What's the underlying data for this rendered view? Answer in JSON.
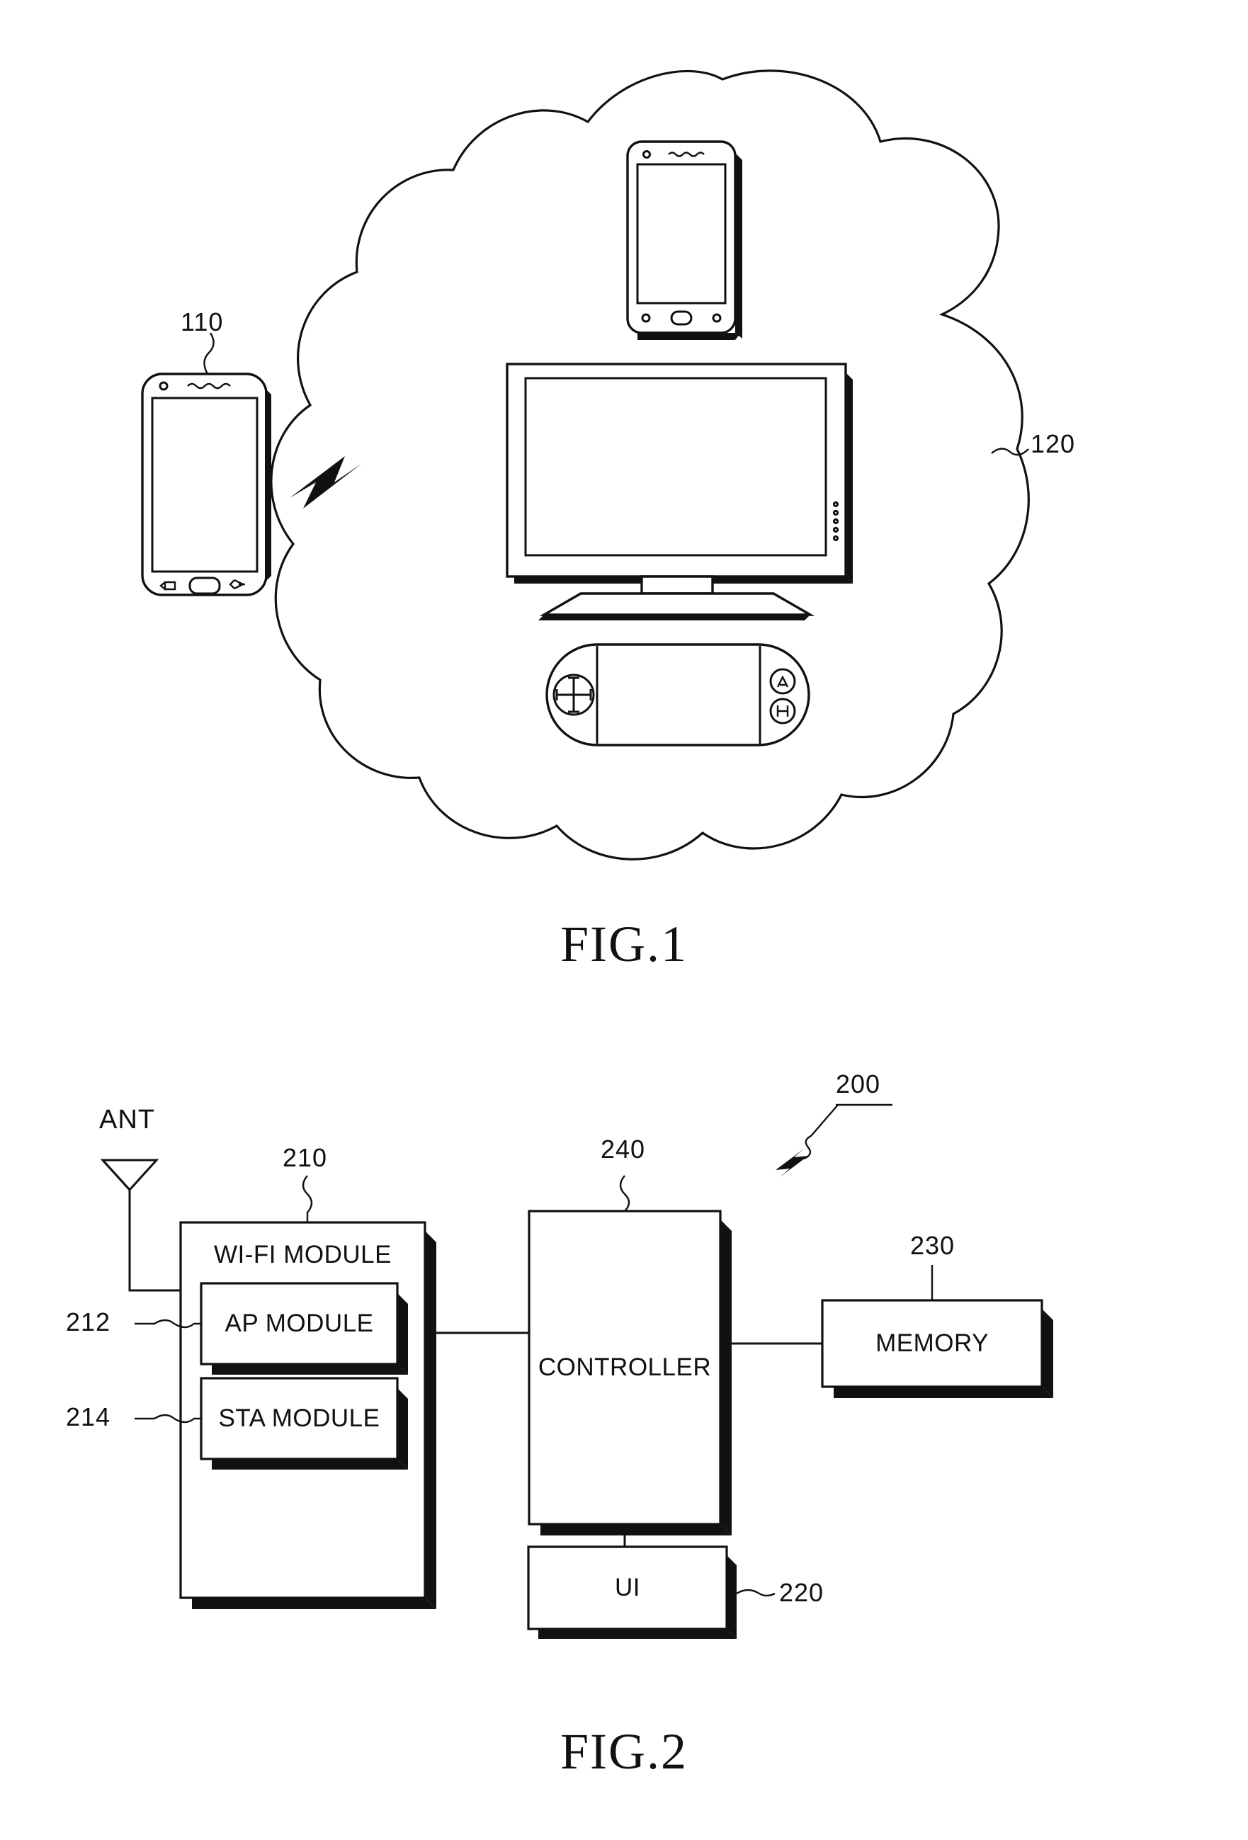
{
  "document": {
    "type": "patent-drawing-sheet",
    "figures": [
      {
        "id": "fig1",
        "caption": "FIG.1",
        "reference_numerals": [
          {
            "label": "110",
            "refers_to": "mobile-terminal"
          },
          {
            "label": "120",
            "refers_to": "device-group-cloud"
          }
        ],
        "elements": {
          "source_phone": "smartphone",
          "wireless_link": "lightning-bolt",
          "cloud_devices": [
            "smartphone",
            "television",
            "handheld-game-console"
          ]
        }
      },
      {
        "id": "fig2",
        "caption": "FIG.2",
        "reference_numerals": [
          {
            "label": "200",
            "refers_to": "electronic-device"
          },
          {
            "label": "210",
            "refers_to": "wifi-module"
          },
          {
            "label": "212",
            "refers_to": "ap-module"
          },
          {
            "label": "214",
            "refers_to": "sta-module"
          },
          {
            "label": "220",
            "refers_to": "ui"
          },
          {
            "label": "230",
            "refers_to": "memory"
          },
          {
            "label": "240",
            "refers_to": "controller"
          }
        ],
        "antenna_label": "ANT",
        "blocks": [
          {
            "key": "wifi",
            "text": "WI-FI MODULE"
          },
          {
            "key": "ap",
            "text": "AP MODULE"
          },
          {
            "key": "sta",
            "text": "STA MODULE"
          },
          {
            "key": "controller",
            "text": "CONTROLLER"
          },
          {
            "key": "memory",
            "text": "MEMORY"
          },
          {
            "key": "ui",
            "text": "UI"
          }
        ]
      }
    ]
  },
  "fig1": {
    "caption": "FIG.1",
    "num_110": "110",
    "num_120": "120"
  },
  "fig2": {
    "caption": "FIG.2",
    "num_200": "200",
    "num_210": "210",
    "num_212": "212",
    "num_214": "214",
    "num_220": "220",
    "num_230": "230",
    "num_240": "240",
    "ant": "ANT",
    "wifi_module": "WI-FI MODULE",
    "ap_module": "AP MODULE",
    "sta_module": "STA MODULE",
    "controller": "CONTROLLER",
    "memory": "MEMORY",
    "ui": "UI"
  },
  "colors": {
    "ink": "#111111",
    "paper": "#ffffff"
  }
}
